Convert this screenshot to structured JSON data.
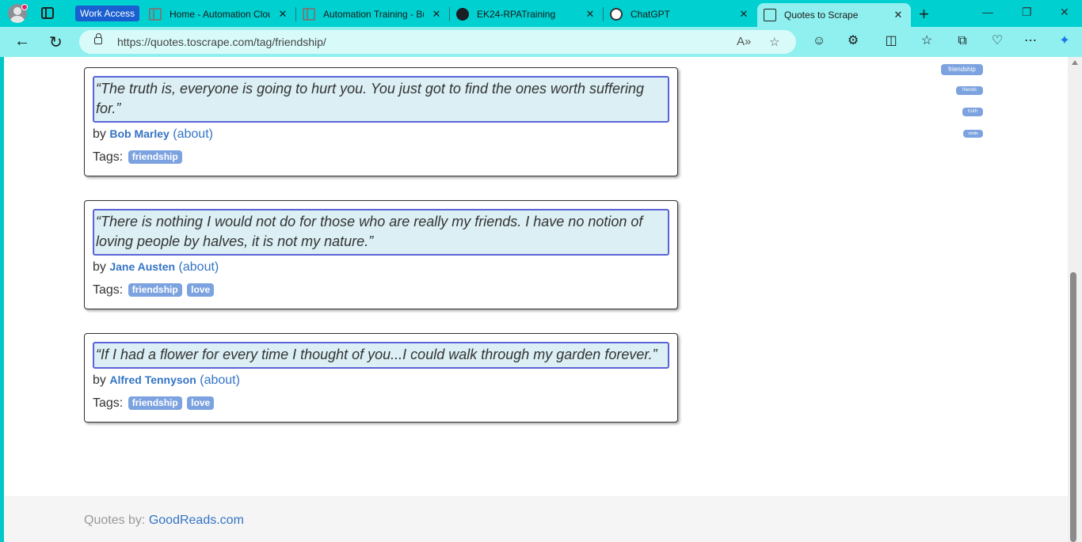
{
  "browser": {
    "work_access_label": "Work Access",
    "tabs": [
      {
        "title": "Home - Automation Cloud",
        "icon": "automation-cloud-icon"
      },
      {
        "title": "Automation Training - Bu",
        "icon": "automation-training-icon"
      },
      {
        "title": "EK24-RPATraining",
        "icon": "github-icon"
      },
      {
        "title": "ChatGPT",
        "icon": "chatgpt-icon"
      },
      {
        "title": "Quotes to Scrape",
        "icon": "document-icon",
        "active": true
      }
    ],
    "url": "https://quotes.toscrape.com/tag/friendship/"
  },
  "quotes": [
    {
      "text": "“The truth is, everyone is going to hurt you. You just got to find the ones worth suffering for.”",
      "by": "by",
      "author": "Bob Marley",
      "about": "(about)",
      "tags_label": "Tags:",
      "tags": [
        "friendship"
      ]
    },
    {
      "text": "“There is nothing I would not do for those who are really my friends. I have no notion of loving people by halves, it is not my nature.”",
      "by": "by",
      "author": "Jane Austen",
      "about": "(about)",
      "tags_label": "Tags:",
      "tags": [
        "friendship",
        "love"
      ]
    },
    {
      "text": "“If I had a flower for every time I thought of you...I could walk through my garden forever.”",
      "by": "by",
      "author": "Alfred Tennyson",
      "about": "(about)",
      "tags_label": "Tags:",
      "tags": [
        "friendship",
        "love"
      ]
    }
  ],
  "top_tags": [
    "friendship",
    "friends",
    "truth",
    "simile"
  ],
  "footer": {
    "prefix": "Quotes by:",
    "link": "GoodReads.com"
  }
}
